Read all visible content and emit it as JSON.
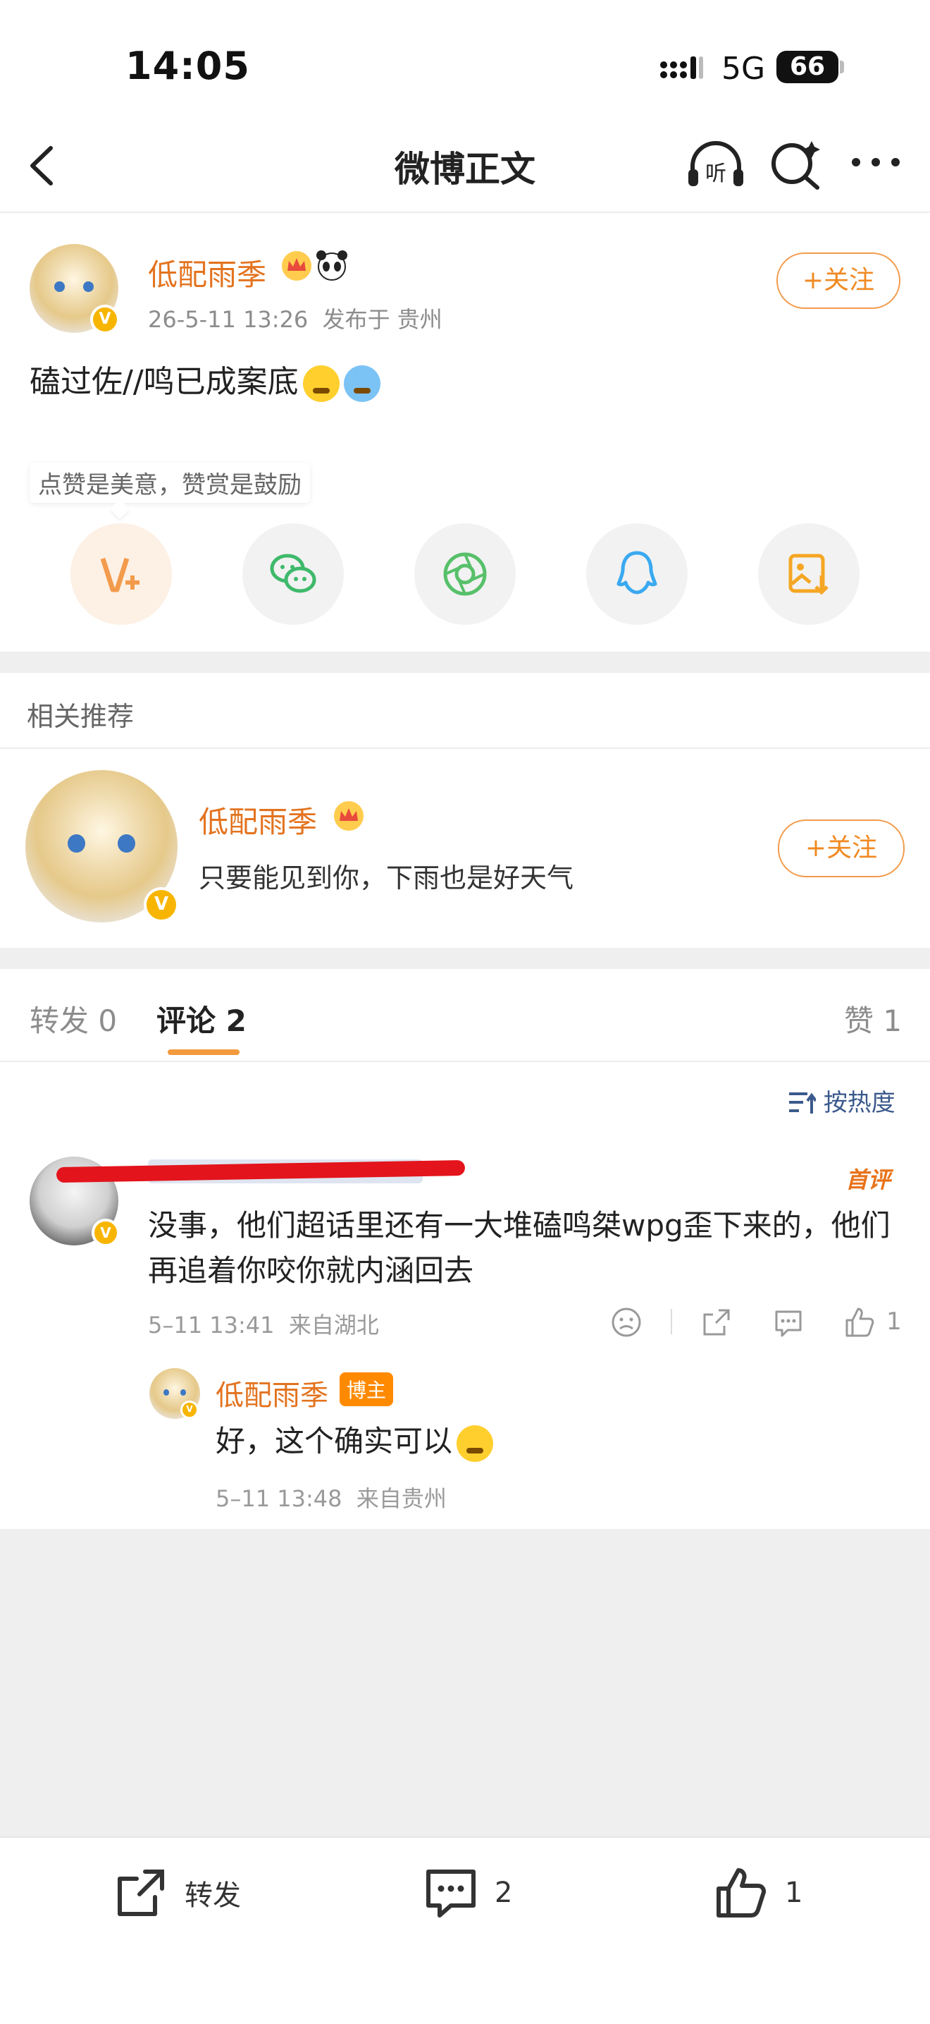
{
  "status_bar": {
    "time": "14:05",
    "network": "5G",
    "battery": "66"
  },
  "nav": {
    "title": "微博正文",
    "back_icon": "back-chevron-icon",
    "listen_label": "听"
  },
  "post": {
    "author": "低配雨季",
    "time": "26-5-11 13:26",
    "location": "发布于 贵州",
    "follow_label": "+关注",
    "text": "磕过佐//鸣已成案底"
  },
  "reward_tip": "点赞是美意，赞赏是鼓励",
  "share_icons": [
    "reward-icon",
    "wechat-icon",
    "moments-icon",
    "qq-icon",
    "save-image-icon"
  ],
  "recommend": {
    "section_title": "相关推荐",
    "name": "低配雨季",
    "desc": "只要能见到你，下雨也是好天气",
    "follow_label": "+关注"
  },
  "tabs": {
    "repost": "转发 0",
    "comment": "评论 2",
    "like": "赞 1"
  },
  "sort_label": "按热度",
  "comment": {
    "first_badge": "首评",
    "text": "没事，他们超话里还有一大堆磕鸣桀wpg歪下来的，他们再追着你咬你就内涵回去",
    "time": "5–11 13:41",
    "location": "来自湖北",
    "likes": "1"
  },
  "reply": {
    "name": "低配雨季",
    "badge": "博主",
    "text": "好，这个确实可以",
    "time": "5–11 13:48",
    "location": "来自贵州"
  },
  "bottom_bar": {
    "repost_label": "转发",
    "comment_count": "2",
    "like_count": "1"
  },
  "colors": {
    "accent": "#e3731f",
    "follow_border": "#f29b4c",
    "tab_underline": "#f39a3e"
  }
}
